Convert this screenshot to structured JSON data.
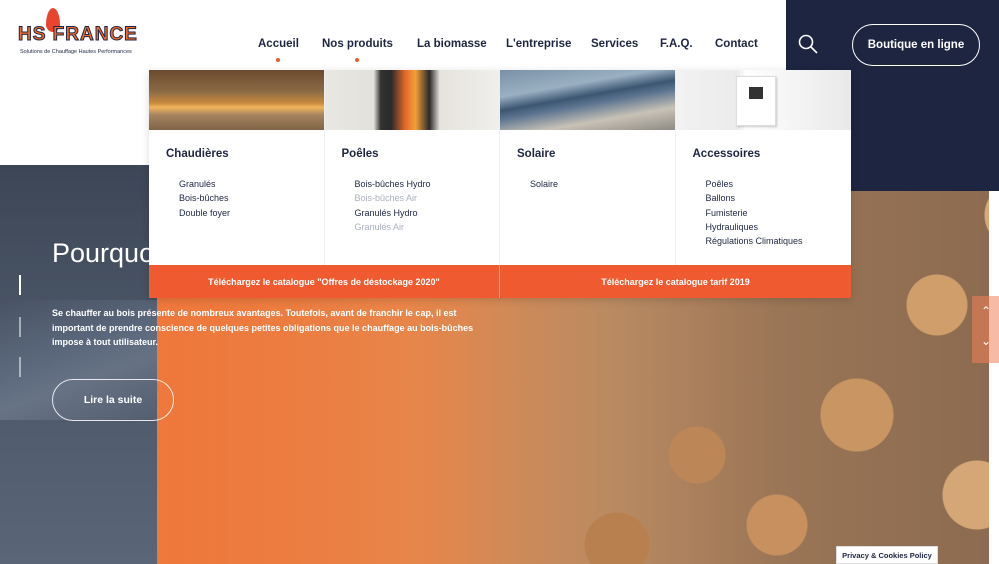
{
  "logo": {
    "brand": "HS FRANCE",
    "tagline": "Solutions de Chauffage Hautes Performances"
  },
  "nav": {
    "items": [
      {
        "label": "Accueil"
      },
      {
        "label": "Nos produits"
      },
      {
        "label": "La biomasse"
      },
      {
        "label": "L'entreprise"
      },
      {
        "label": "Services"
      },
      {
        "label": "F.A.Q."
      },
      {
        "label": "Contact"
      }
    ],
    "shop_label": "Boutique en ligne"
  },
  "icons": {
    "search": "search-icon",
    "arrow_up": "chevron-up-icon",
    "arrow_down": "chevron-down-icon"
  },
  "mega_menu": {
    "columns": [
      {
        "title": "Chaudières",
        "links": [
          "Granulés",
          "Bois-bûches",
          "Double foyer"
        ]
      },
      {
        "title": "Poêles",
        "links": [
          "Bois-bûches Hydro",
          "Bois-bûches Air",
          "Granulés Hydro",
          "Granulés Air"
        ]
      },
      {
        "title": "Solaire",
        "links": [
          "Solaire"
        ]
      },
      {
        "title": "Accessoires",
        "links": [
          "Poêles",
          "Ballons",
          "Fumisterie",
          "Hydrauliques",
          "Régulations Climatiques"
        ]
      }
    ],
    "catalog_buttons": [
      "Téléchargez le catalogue \"Offres de déstockage 2020\"",
      "Téléchargez le catalogue tarif 2019"
    ]
  },
  "hero": {
    "title": "Pourquo",
    "text": "Se chauffer au bois présente de nombreux avantages. Toutefois, avant de franchir le cap, il est important de prendre conscience de quelques petites obligations que le chauffage au bois-bûches impose à tout utilisateur.",
    "read_more": "Lire la suite"
  },
  "footer": {
    "privacy": "Privacy & Cookies Policy"
  },
  "colors": {
    "accent": "#ef5a30",
    "navy": "#1d2540",
    "muted": "#aab0bc"
  }
}
